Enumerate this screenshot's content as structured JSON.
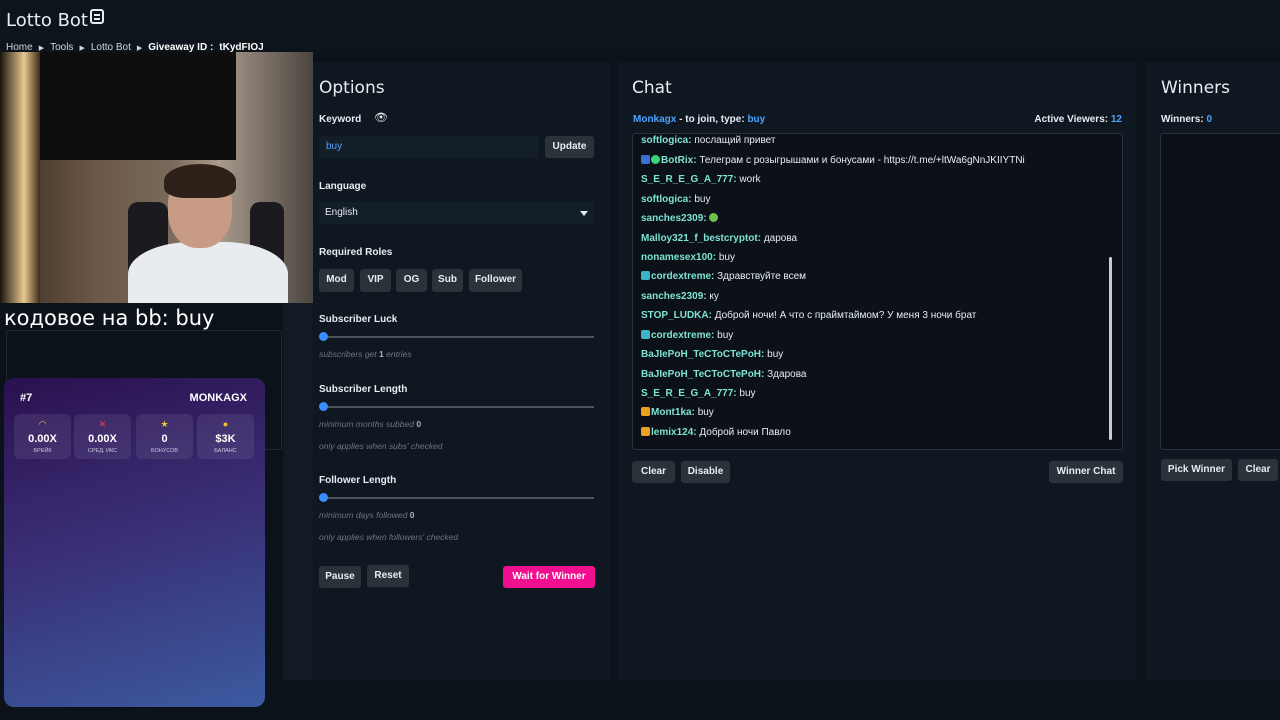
{
  "app": {
    "title": "Lotto Bot",
    "breadcrumb": [
      "Home",
      "Tools",
      "Lotto Bot"
    ],
    "giveaway_label": "Giveaway ID :",
    "giveaway_id": "tKydFIOJ"
  },
  "options": {
    "title": "Options",
    "keyword_label": "Keyword",
    "keyword_value": "buy",
    "update_label": "Update",
    "language_label": "Language",
    "language_value": "English",
    "roles_label": "Required Roles",
    "roles": [
      "Mod",
      "VIP",
      "OG",
      "Sub",
      "Follower"
    ],
    "sub_luck_label": "Subscriber Luck",
    "sub_luck_note_pre": "subscribers get",
    "sub_luck_value": "1",
    "sub_luck_note_post": "entries",
    "sub_length_label": "Subscriber Length",
    "sub_length_note": "minimum months subbed",
    "sub_length_value": "0",
    "sub_length_note2": "only applies when subs' checked",
    "follower_length_label": "Follower Length",
    "follower_length_note": "minimum days followed",
    "follower_length_value": "0",
    "follower_length_note2": "only applies when followers' checked",
    "pause_label": "Pause",
    "reset_label": "Reset",
    "wait_label": "Wait for Winner"
  },
  "chat": {
    "title": "Chat",
    "join_user": "Monkagx",
    "join_text": "- to join, type:",
    "join_keyword": "buy",
    "viewers_label": "Active Viewers:",
    "viewers_count": "12",
    "messages": [
      {
        "user": "softlogica:",
        "text": "послащий привет",
        "icon": ""
      },
      {
        "user": "BotRix:",
        "text": "Телеграм с розыгрышами и бонусами - https://t.me/+ltWa6gNnJKIIYTNi",
        "icon": "bot"
      },
      {
        "user": "S_E_R_E_G_A_777:",
        "text": "work",
        "icon": ""
      },
      {
        "user": "softlogica:",
        "text": "buy",
        "icon": ""
      },
      {
        "user": "sanches2309:",
        "text": "",
        "icon": "emote"
      },
      {
        "user": "Malloy321_f_bestcryptot:",
        "text": "дарова",
        "icon": ""
      },
      {
        "user": "nonamesex100:",
        "text": "buy",
        "icon": ""
      },
      {
        "user": "cordextreme:",
        "text": "Здравствуйте всем",
        "icon": "badge"
      },
      {
        "user": "sanches2309:",
        "text": "ку",
        "icon": ""
      },
      {
        "user": "STOP_LUDKA:",
        "text": "Доброй ночи! А что с праймтаймом? У меня 3 ночи брат",
        "icon": ""
      },
      {
        "user": "cordextreme:",
        "text": "buy",
        "icon": "badge"
      },
      {
        "user": "BaJIePoH_TeCToCTePoH:",
        "text": "buy",
        "icon": ""
      },
      {
        "user": "BaJIePoH_TeCToCTePoH:",
        "text": "Здарова",
        "icon": ""
      },
      {
        "user": "S_E_R_E_G_A_777:",
        "text": "buy",
        "icon": ""
      },
      {
        "user": "Mont1ka:",
        "text": "buy",
        "icon": "crown"
      },
      {
        "user": "lemix124:",
        "text": "Доброй ночи Павло",
        "icon": "crown"
      }
    ],
    "clear_label": "Clear",
    "disable_label": "Disable",
    "winner_chat_label": "Winner Chat"
  },
  "winners": {
    "title": "Winners",
    "count_label": "Winners:",
    "count": "0",
    "pick_label": "Pick Winner",
    "clear_label": "Clear"
  },
  "overlay": {
    "stream_text": "кодовое на bb: buy",
    "card_num": "#7",
    "card_name": "MONKAGX",
    "stats": [
      {
        "icon": "headset-icon",
        "value": "0.00X",
        "label": "БРЕЙК",
        "color": "#f2c230"
      },
      {
        "icon": "cross-icon",
        "value": "0.00X",
        "label": "СРЕД. ИКС",
        "color": "#ff3b3b"
      },
      {
        "icon": "star-icon",
        "value": "0",
        "label": "БОНУСОВ",
        "color": "#f2c230"
      },
      {
        "icon": "coin-icon",
        "value": "$3K",
        "label": "БАЛАНС",
        "color": "#f2c230"
      }
    ]
  }
}
